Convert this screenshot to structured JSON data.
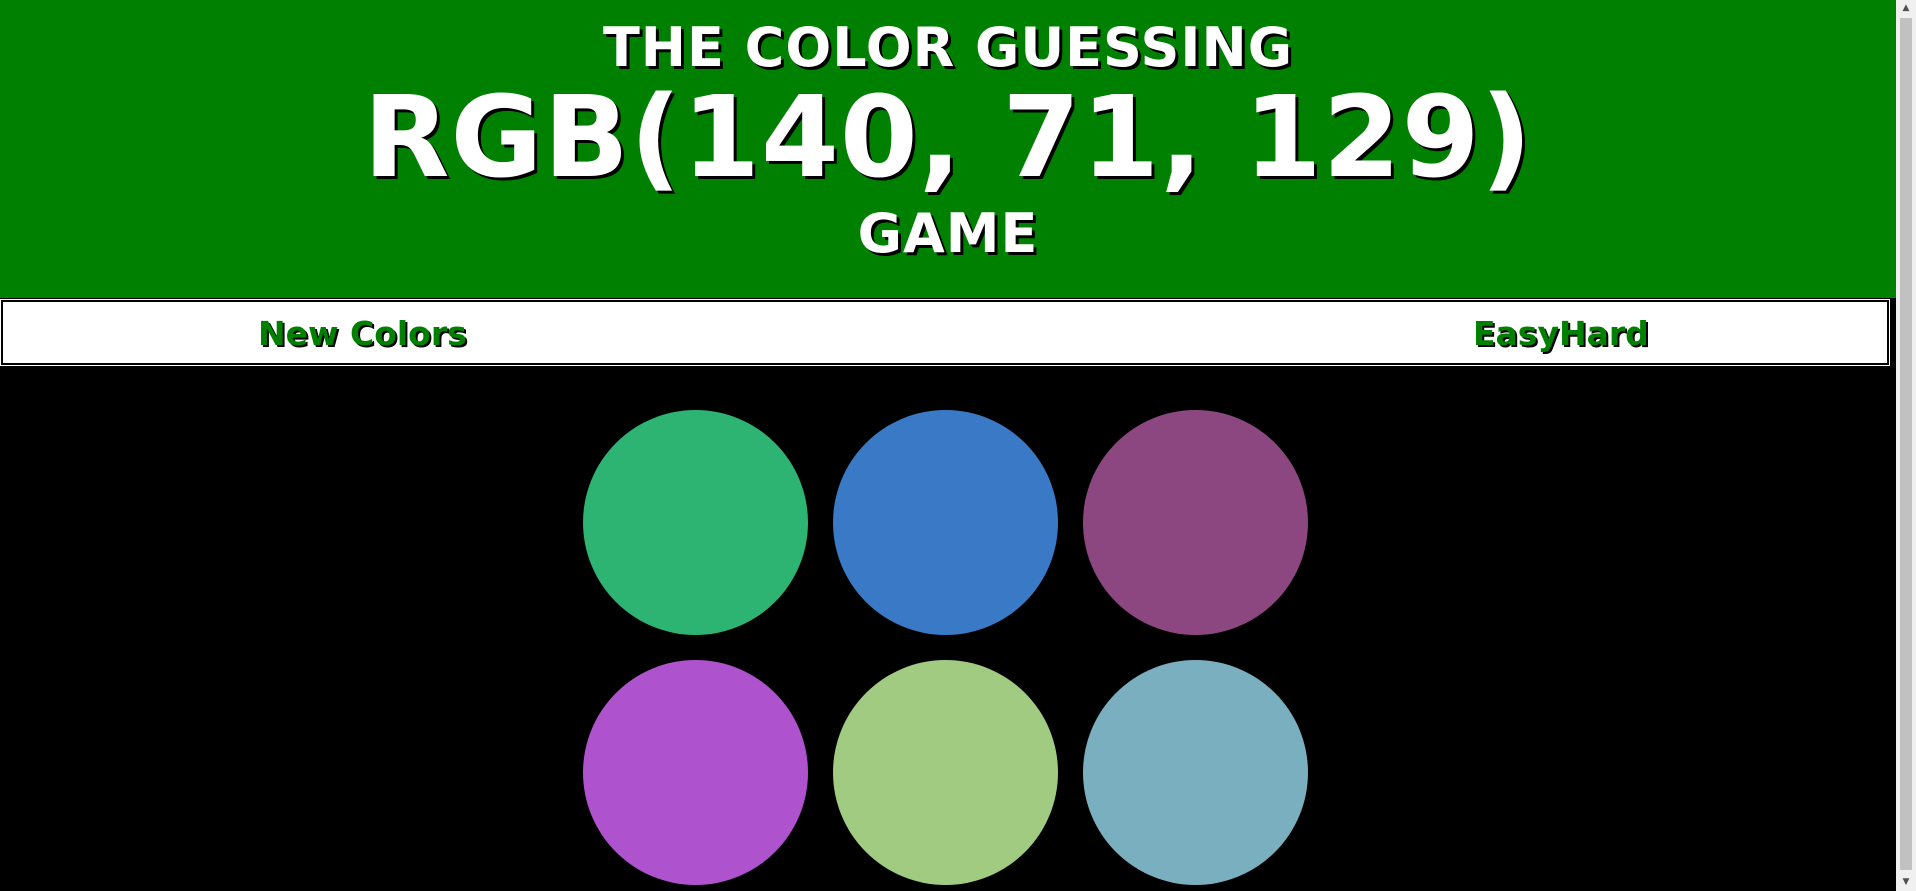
{
  "header": {
    "title_top": "THE COLOR GUESSING",
    "rgb_target": "RGB(140, 71, 129)",
    "title_bottom": "GAME",
    "background": "#008000"
  },
  "controls": {
    "new_colors_label": "New Colors",
    "easy_label": "Easy",
    "hard_label": "Hard",
    "accent": "#008000"
  },
  "squares": [
    {
      "color": "#2db372"
    },
    {
      "color": "#3a79c6"
    },
    {
      "color": "#8c4781"
    },
    {
      "color": "#ae52cd"
    },
    {
      "color": "#a0cb80"
    },
    {
      "color": "#79afbe"
    }
  ],
  "scrollbar": {
    "up_icon": "arrow-up-icon",
    "down_icon": "arrow-down-icon"
  }
}
